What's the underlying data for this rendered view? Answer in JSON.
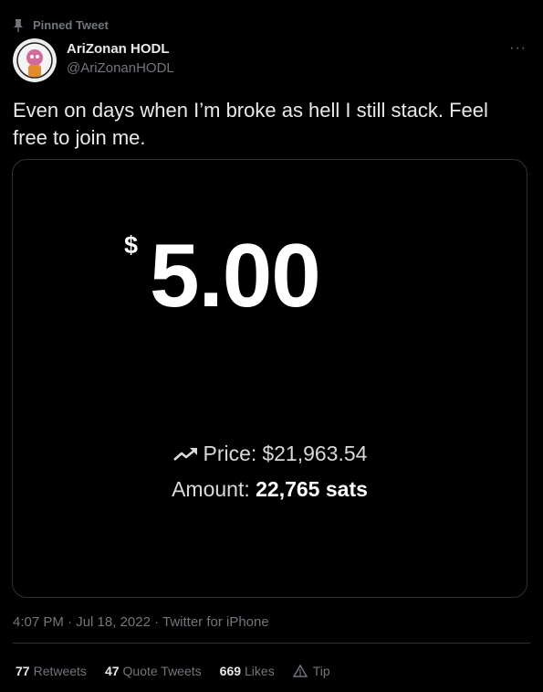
{
  "pinned": {
    "label": "Pinned Tweet"
  },
  "author": {
    "name": "AriZonan HODL",
    "handle": "@AriZonanHODL"
  },
  "more_label": "···",
  "tweet": {
    "text": "Even on days when I’m broke as hell I still stack. Feel free to join me."
  },
  "media": {
    "currency_symbol": "$",
    "amount": "5.00",
    "price_label": "Price:",
    "price_value": "$21,963.54",
    "amount_label": "Amount:",
    "amount_value": "22,765 sats"
  },
  "meta": {
    "text": "4:07 PM · Jul 18, 2022 · Twitter for iPhone"
  },
  "stats": {
    "retweets_count": "77",
    "retweets_label": "Retweets",
    "quotes_count": "47",
    "quotes_label": "Quote Tweets",
    "likes_count": "669",
    "likes_label": "Likes",
    "tip_label": "Tip"
  },
  "icons": {
    "pin": "pin-icon",
    "more": "more-icon",
    "trend": "trend-up-icon",
    "tip": "tip-icon"
  },
  "colors": {
    "background": "#000000",
    "text": "#e7e9ea",
    "muted": "#71767b",
    "border": "#2f3336"
  }
}
